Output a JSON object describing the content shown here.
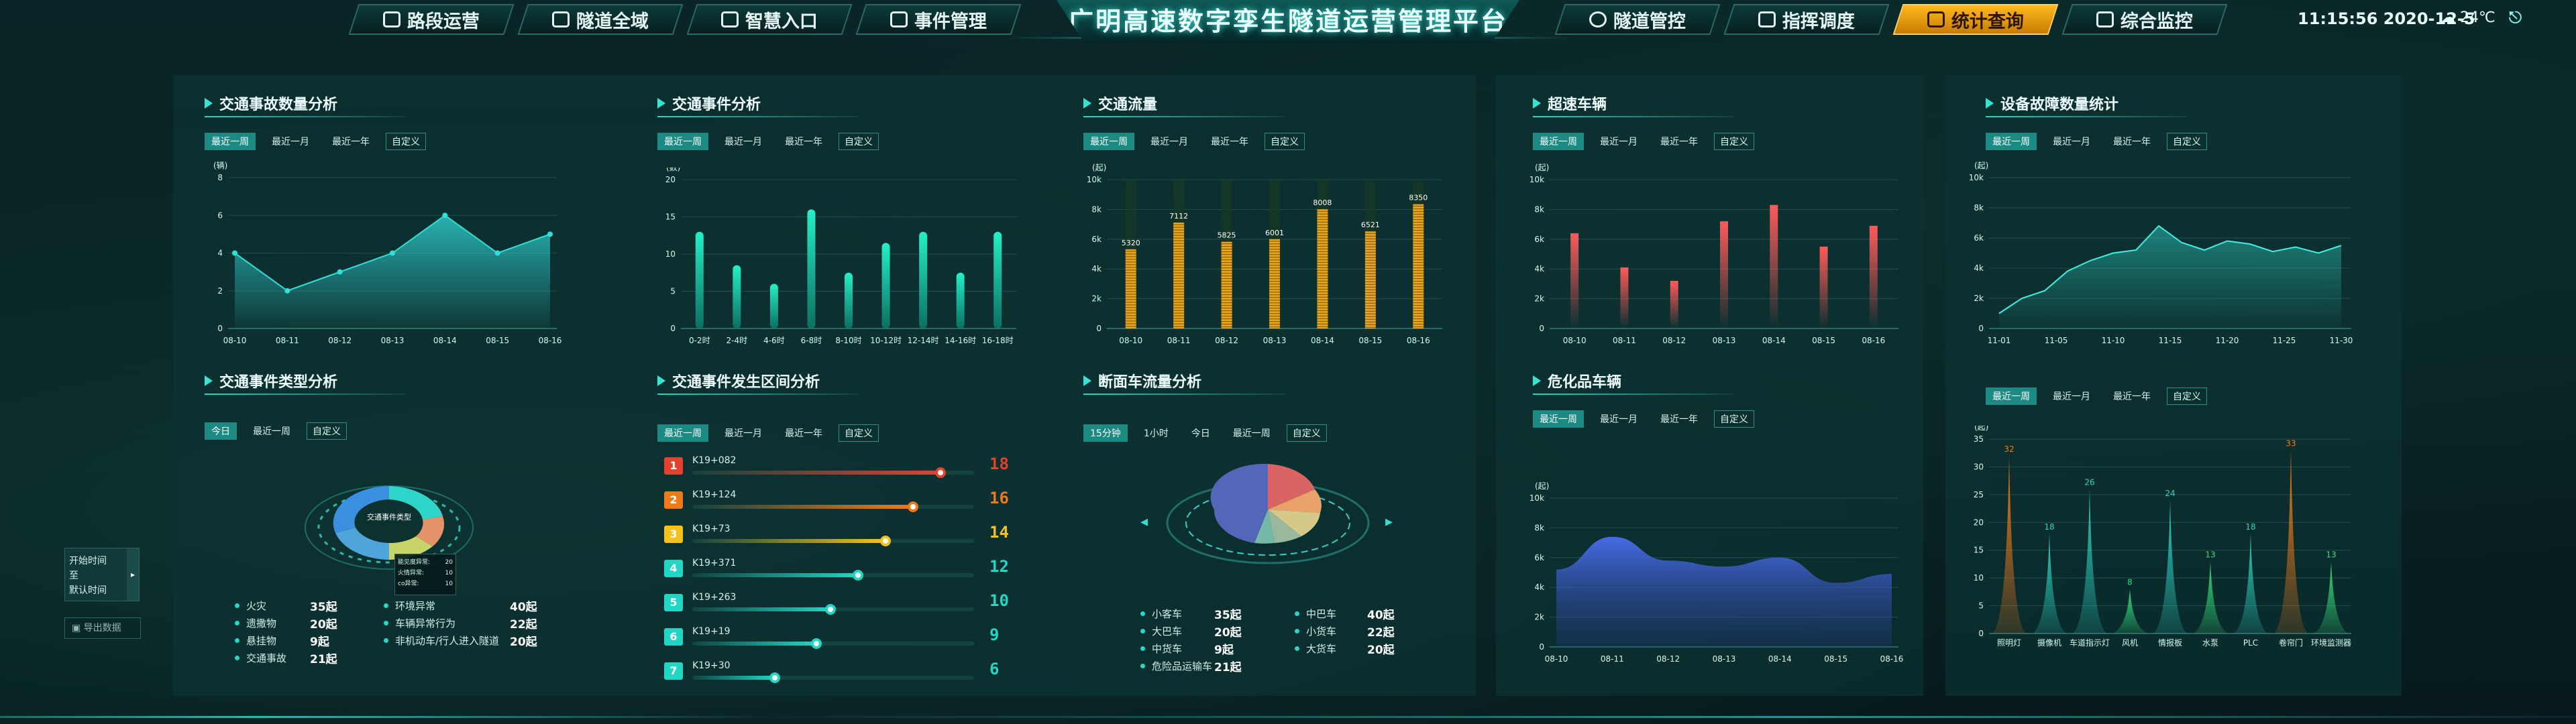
{
  "nav": {
    "left": [
      {
        "label": "路段运营",
        "icon": "car-icon"
      },
      {
        "label": "隧道全域",
        "icon": "tunnel-icon"
      },
      {
        "label": "智慧入口",
        "icon": "gate-icon"
      },
      {
        "label": "事件管理",
        "icon": "list-icon"
      }
    ],
    "title": "广明高速数字孪生隧道运营管理平台",
    "right": [
      {
        "label": "隧道管控",
        "icon": "location-icon"
      },
      {
        "label": "指挥调度",
        "icon": "dispatch-icon"
      },
      {
        "label": "统计查询",
        "icon": "stats-icon",
        "active": true
      },
      {
        "label": "综合监控",
        "icon": "monitor-icon"
      }
    ],
    "time": "11:15:56 2020-12-5",
    "weather": "24℃",
    "weather_icon": "cloud-icon",
    "exit_icon": "exit-icon"
  },
  "colors": {
    "accent": "#2fe0cf",
    "active_nav": "#ffb81f"
  },
  "filters_week": [
    "最近一周",
    "最近一月",
    "最近一年"
  ],
  "custom_label": "自定义",
  "panels": {
    "accident": {
      "title": "交通事故数量分析",
      "unit": "(辆)"
    },
    "event": {
      "title": "交通事件分析",
      "unit": "(数)"
    },
    "flow": {
      "title": "交通流量",
      "unit": "(起)"
    },
    "speeding": {
      "title": "超速车辆",
      "unit": "(起)"
    },
    "faults": {
      "title": "设备故障数量统计",
      "unit": "(起)"
    },
    "eventtype": {
      "title": "交通事件类型分析",
      "filters": [
        "今日",
        "最近一周"
      ],
      "center": "交通事件类型"
    },
    "section": {
      "title": "交通事件发生区间分析"
    },
    "crossflow": {
      "title": "断面车流量分析",
      "filters": [
        "15分钟",
        "1小时",
        "今日",
        "最近一周"
      ]
    },
    "danger": {
      "title": "危化品车辆",
      "unit": "(起)"
    }
  },
  "eventtype_legend": [
    {
      "name": "火灾",
      "value": "35起",
      "color": "#2dd6c9"
    },
    {
      "name": "遗撒物",
      "value": "20起",
      "color": "#3b8fe0"
    },
    {
      "name": "悬挂物",
      "value": "9起",
      "color": "#c7d46a"
    },
    {
      "name": "交通事故",
      "value": "21起",
      "color": "#e4926a"
    },
    {
      "name": "环境异常",
      "value": "40起",
      "color": "#8fd1c3"
    },
    {
      "name": "车辆异常行为",
      "value": "22起",
      "color": "#4fa4d9"
    },
    {
      "name": "非机动车/行人进入隧道",
      "value": "20起",
      "color": "#6fcf8d"
    }
  ],
  "eventtype_tooltip": [
    "能见度异常:",
    "火情异常:",
    "co异常:"
  ],
  "eventtype_tooltip_vals": [
    "20",
    "10",
    "10"
  ],
  "crossflow_legend": [
    {
      "name": "小客车",
      "value": "35起"
    },
    {
      "name": "大巴车",
      "value": "20起"
    },
    {
      "name": "中货车",
      "value": "9起"
    },
    {
      "name": "危险品运输车",
      "value": "21起"
    },
    {
      "name": "中巴车",
      "value": "40起"
    },
    {
      "name": "小货车",
      "value": "22起"
    },
    {
      "name": "大货车",
      "value": "20起"
    }
  ],
  "sections": [
    {
      "rank": "1",
      "label": "K19+082",
      "value": "18",
      "color": "#e5412f"
    },
    {
      "rank": "2",
      "label": "K19+124",
      "value": "16",
      "color": "#f07a1a"
    },
    {
      "rank": "3",
      "label": "K19+73",
      "value": "14",
      "color": "#f3c21b"
    },
    {
      "rank": "4",
      "label": "K19+371",
      "value": "12",
      "color": "#22d6c6"
    },
    {
      "rank": "5",
      "label": "K19+263",
      "value": "10",
      "color": "#22d6c6"
    },
    {
      "rank": "6",
      "label": "K19+19",
      "value": "9",
      "color": "#22d6c6"
    },
    {
      "rank": "7",
      "label": "K19+30",
      "value": "6",
      "color": "#22d6c6"
    }
  ],
  "sidebar": {
    "start": "开始时间",
    "to": "至",
    "end": "默认时间",
    "export": "导出数据"
  },
  "chart_data": [
    {
      "type": "area",
      "id": "accident",
      "x": [
        "08-10",
        "08-11",
        "08-12",
        "08-13",
        "08-14",
        "08-15",
        "08-16"
      ],
      "values": [
        4,
        2,
        3,
        4,
        6,
        4,
        5
      ],
      "ylim": [
        0,
        8
      ],
      "yticks": [
        0,
        2,
        4,
        6,
        8
      ]
    },
    {
      "type": "bar",
      "id": "event",
      "categories": [
        "0-2时",
        "2-4时",
        "4-6时",
        "6-8时",
        "8-10时",
        "10-12时",
        "12-14时",
        "14-16时",
        "16-18时"
      ],
      "values": [
        13,
        8.5,
        6,
        16,
        7.5,
        11.5,
        13,
        7.5,
        13
      ],
      "ylim": [
        0,
        20
      ],
      "yticks": [
        0,
        5,
        10,
        15,
        20
      ]
    },
    {
      "type": "bar",
      "id": "flow",
      "categories": [
        "08-10",
        "08-11",
        "08-12",
        "08-13",
        "08-14",
        "08-15",
        "08-16"
      ],
      "values": [
        5320,
        7112,
        5825,
        6001,
        8008,
        6521,
        8350
      ],
      "ylim": [
        0,
        10000
      ],
      "yticks": [
        "0",
        "2k",
        "4k",
        "6k",
        "8k",
        "10k"
      ]
    },
    {
      "type": "bar",
      "id": "speeding",
      "categories": [
        "08-10",
        "08-11",
        "08-12",
        "08-13",
        "08-14",
        "08-15",
        "08-16"
      ],
      "values": [
        6400,
        4100,
        3200,
        7200,
        8300,
        5500,
        6900
      ],
      "ylim": [
        0,
        10000
      ],
      "yticks": [
        "0",
        "2k",
        "4k",
        "6k",
        "8k",
        "10k"
      ]
    },
    {
      "type": "line",
      "id": "faults",
      "x": [
        "11-01",
        "11-05",
        "11-10",
        "11-15",
        "11-20",
        "11-25",
        "11-30"
      ],
      "values": [
        1000,
        2000,
        2500,
        3800,
        4500,
        5000,
        5200,
        6800,
        5700,
        5200,
        5800,
        5600,
        5100,
        5400,
        5000,
        5500
      ],
      "ylim": [
        0,
        10000
      ],
      "yticks": [
        "0",
        "2k",
        "4k",
        "6k",
        "8k",
        "10k"
      ]
    },
    {
      "type": "area",
      "id": "danger",
      "x": [
        "08-10",
        "08-11",
        "08-12",
        "08-13",
        "08-14",
        "08-15",
        "08-16"
      ],
      "values": [
        5200,
        7400,
        5800,
        5400,
        6000,
        4300,
        4900
      ],
      "ylim": [
        0,
        10000
      ],
      "yticks": [
        "0",
        "2k",
        "4k",
        "6k",
        "8k",
        "10k"
      ]
    },
    {
      "type": "bar",
      "id": "devices",
      "categories": [
        "照明灯",
        "摄像机",
        "车道指示灯",
        "风机",
        "情报板",
        "水泵",
        "PLC",
        "卷帘门",
        "环境监测器"
      ],
      "values": [
        32,
        18,
        26,
        8,
        24,
        13,
        18,
        33,
        13
      ],
      "ylim": [
        0,
        35
      ],
      "yticks": [
        0,
        5,
        10,
        15,
        20,
        25,
        30,
        35
      ],
      "unit": "(起)"
    }
  ]
}
